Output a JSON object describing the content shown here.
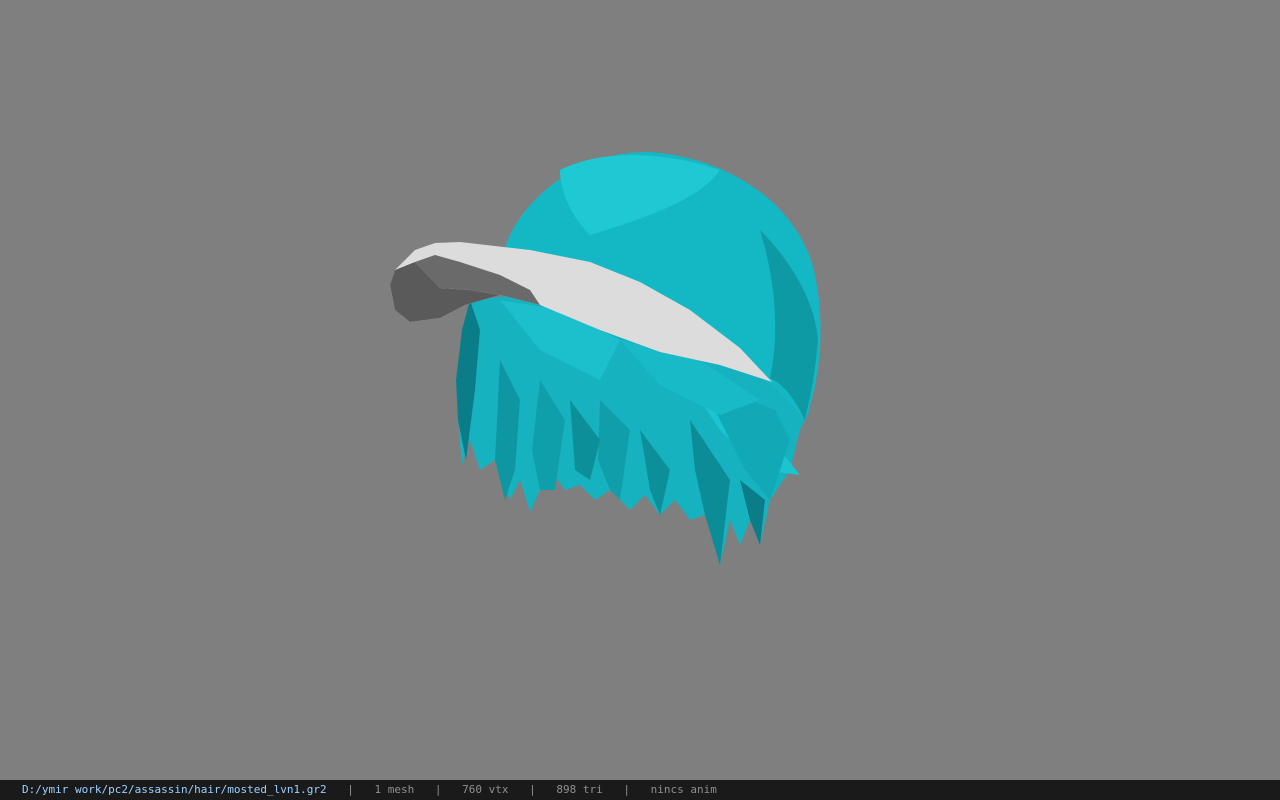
{
  "viewport": {
    "background": "#7f7f7f",
    "model_colors": {
      "cap": "#14b8c4",
      "cap_light": "#1fc9d4",
      "cap_shadow": "#0e9aa5",
      "brim_top": "#dcdcdc",
      "brim_under": "#5a5a5a",
      "hair": "#17b2c0",
      "hair_dark": "#0b7d88"
    }
  },
  "status": {
    "file_path": "D:/ymir work/pc2/assassin/hair/mosted_lvn1.gr2",
    "separator": "|",
    "mesh_count": "1 mesh",
    "vertex_count": "760 vtx",
    "triangle_count": "898 tri",
    "anim": "nincs anim"
  }
}
